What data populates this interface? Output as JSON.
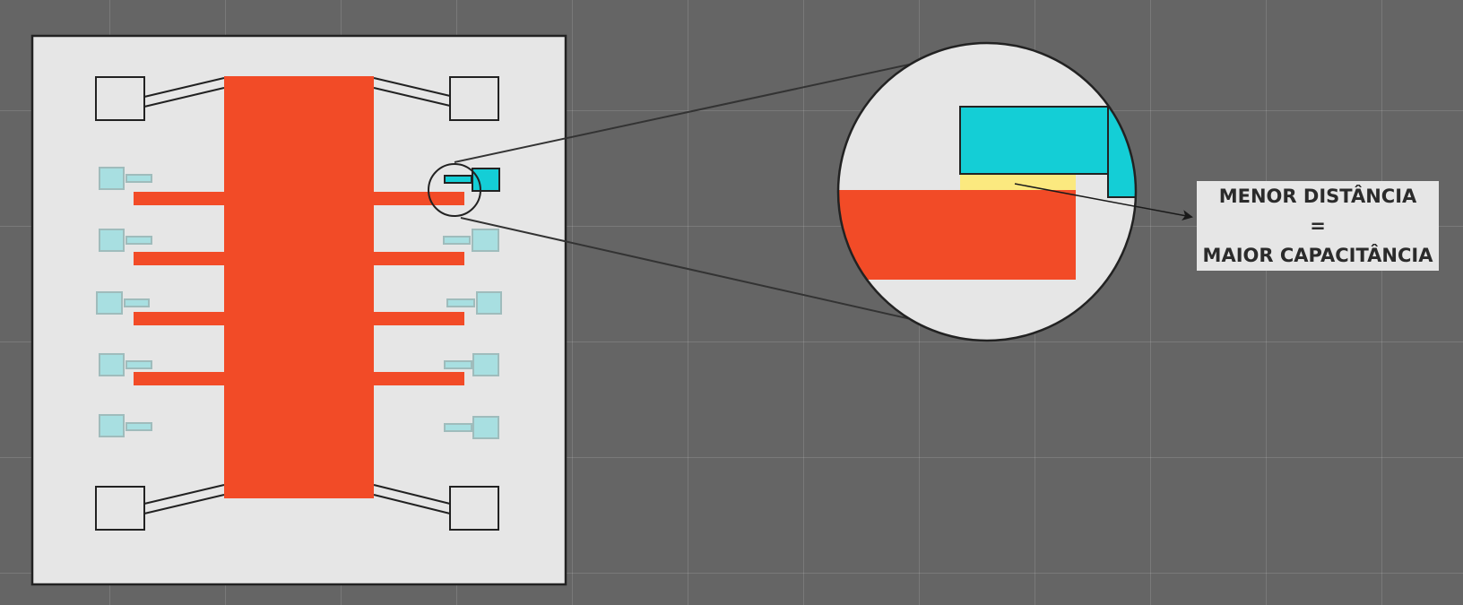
{
  "caption": {
    "line1": "MENOR DISTÂNCIA",
    "line2": "=",
    "line3": "MAIOR CAPACITÂNCIA"
  },
  "colors": {
    "background": "#656565",
    "board": "#e6e6e6",
    "copper_red": "#f24b27",
    "cyan_plate": "#14ced6",
    "light_plate": "#a8dfe1",
    "gap_highlight": "#fbe97f",
    "outline": "#222222"
  },
  "icons": {
    "arrow": "arrow-head-icon"
  }
}
